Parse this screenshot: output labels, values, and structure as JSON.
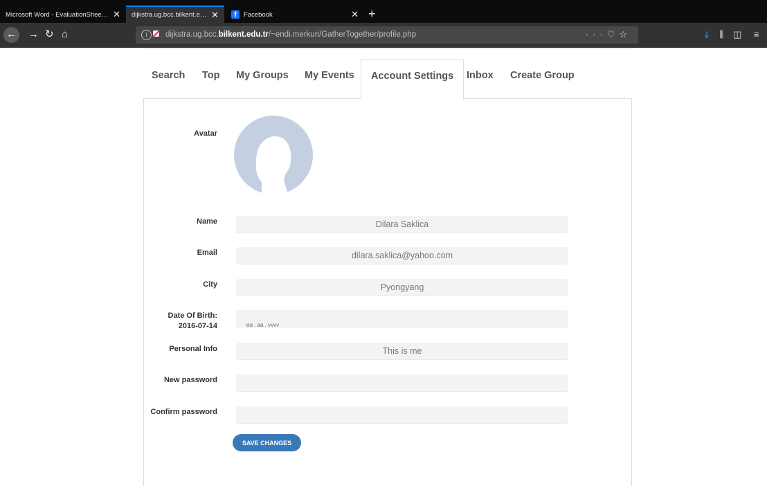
{
  "browser": {
    "tabs": [
      {
        "title": "Microsoft Word - EvaluationSheet.d",
        "active": false
      },
      {
        "title": "dijkstra.ug.bcc.bilkent.edu.tr/~endi",
        "active": true
      },
      {
        "title": "Facebook",
        "active": false
      }
    ],
    "url_prefix": "dijkstra.ug.bcc.",
    "url_domain": "bilkent.edu.tr",
    "url_path": "/~endi.merkuri/GatherTogether/profile.php"
  },
  "site_tabs": [
    "Search",
    "Top",
    "My Groups",
    "My Events",
    "Account Settings",
    "Inbox",
    "Create Group"
  ],
  "active_tab": "Account Settings",
  "form": {
    "avatar_label": "Avatar",
    "name_label": "Name",
    "name_value": "Dilara Saklica",
    "email_label": "Email",
    "email_value": "dilara.saklica@yahoo.com",
    "city_label": "City",
    "city_value": "Pyongyang",
    "dob_label": "Date Of Birth:",
    "dob_value": "2016-07-14",
    "dob_placeholder": "gg . aa . yyyy",
    "info_label": "Personal Info",
    "info_value": "This is me",
    "new_password_label": "New password",
    "confirm_password_label": "Confirm password",
    "save_label": "SAVE CHANGES"
  },
  "colors": {
    "accent": "#3a79b7",
    "avatar": "#c5cfe2",
    "field_bg": "#f3f3f3",
    "browser_chrome": "#323234",
    "tab_accent": "#0a84ff"
  }
}
